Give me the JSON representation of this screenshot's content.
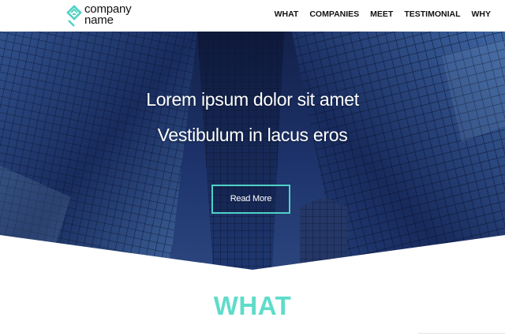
{
  "brand": {
    "name_line1": "company",
    "name_line2": "name",
    "accent_color": "#4fd1c5",
    "logo_icon": "diamond-logo-icon"
  },
  "nav": {
    "items": [
      "WHAT",
      "COMPANIES",
      "MEET",
      "TESTIMONIAL",
      "WHY"
    ]
  },
  "hero": {
    "line1": "Lorem ipsum dolor sit amet",
    "line2": "Vestibulum in lacus eros",
    "button_label": "Read More",
    "background": "glass-skyscrapers-photo"
  },
  "section": {
    "title": "WHAT",
    "title_color": "#5fdcc9"
  }
}
